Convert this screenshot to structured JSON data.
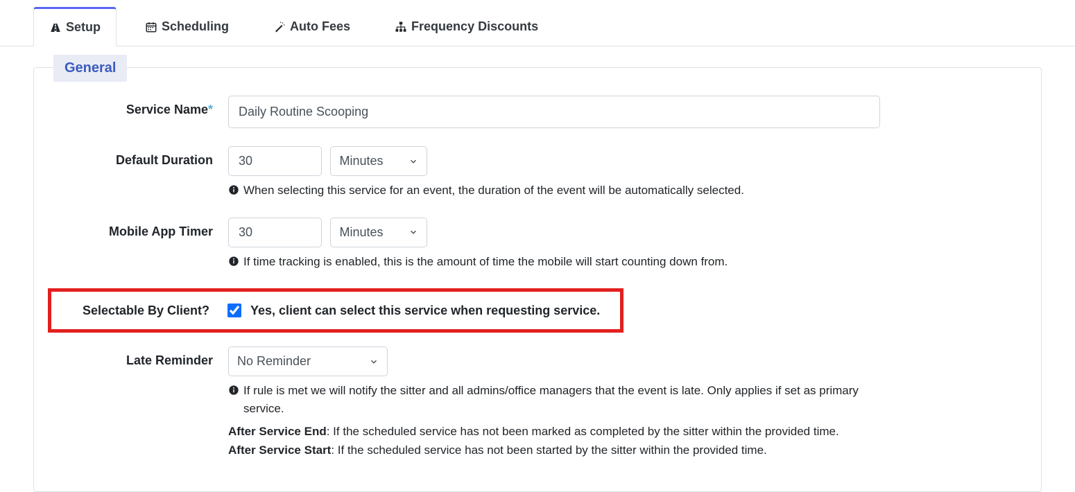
{
  "tabs": [
    {
      "label": "Setup",
      "icon": "road"
    },
    {
      "label": "Scheduling",
      "icon": "calendar"
    },
    {
      "label": "Auto Fees",
      "icon": "wand"
    },
    {
      "label": "Frequency Discounts",
      "icon": "sitemap"
    }
  ],
  "section": {
    "title": "General"
  },
  "fields": {
    "serviceName": {
      "label": "Service Name",
      "value": "Daily Routine Scooping"
    },
    "defaultDuration": {
      "label": "Default Duration",
      "value": "30",
      "unit": "Minutes",
      "help": "When selecting this service for an event, the duration of the event will be automatically selected."
    },
    "mobileTimer": {
      "label": "Mobile App Timer",
      "value": "30",
      "unit": "Minutes",
      "help": "If time tracking is enabled, this is the amount of time the mobile will start counting down from."
    },
    "selectable": {
      "label": "Selectable By Client?",
      "checkboxLabel": "Yes, client can select this service when requesting service.",
      "checked": true
    },
    "lateReminder": {
      "label": "Late Reminder",
      "value": "No Reminder",
      "help1": "If rule is met we will notify the sitter and all admins/office managers that the event is late. Only applies if set as primary service.",
      "rule1Label": "After Service End",
      "rule1Text": ": If the scheduled service has not been marked as completed by the sitter within the provided time.",
      "rule2Label": "After Service Start",
      "rule2Text": ": If the scheduled service has not been started by the sitter within the provided time."
    }
  }
}
